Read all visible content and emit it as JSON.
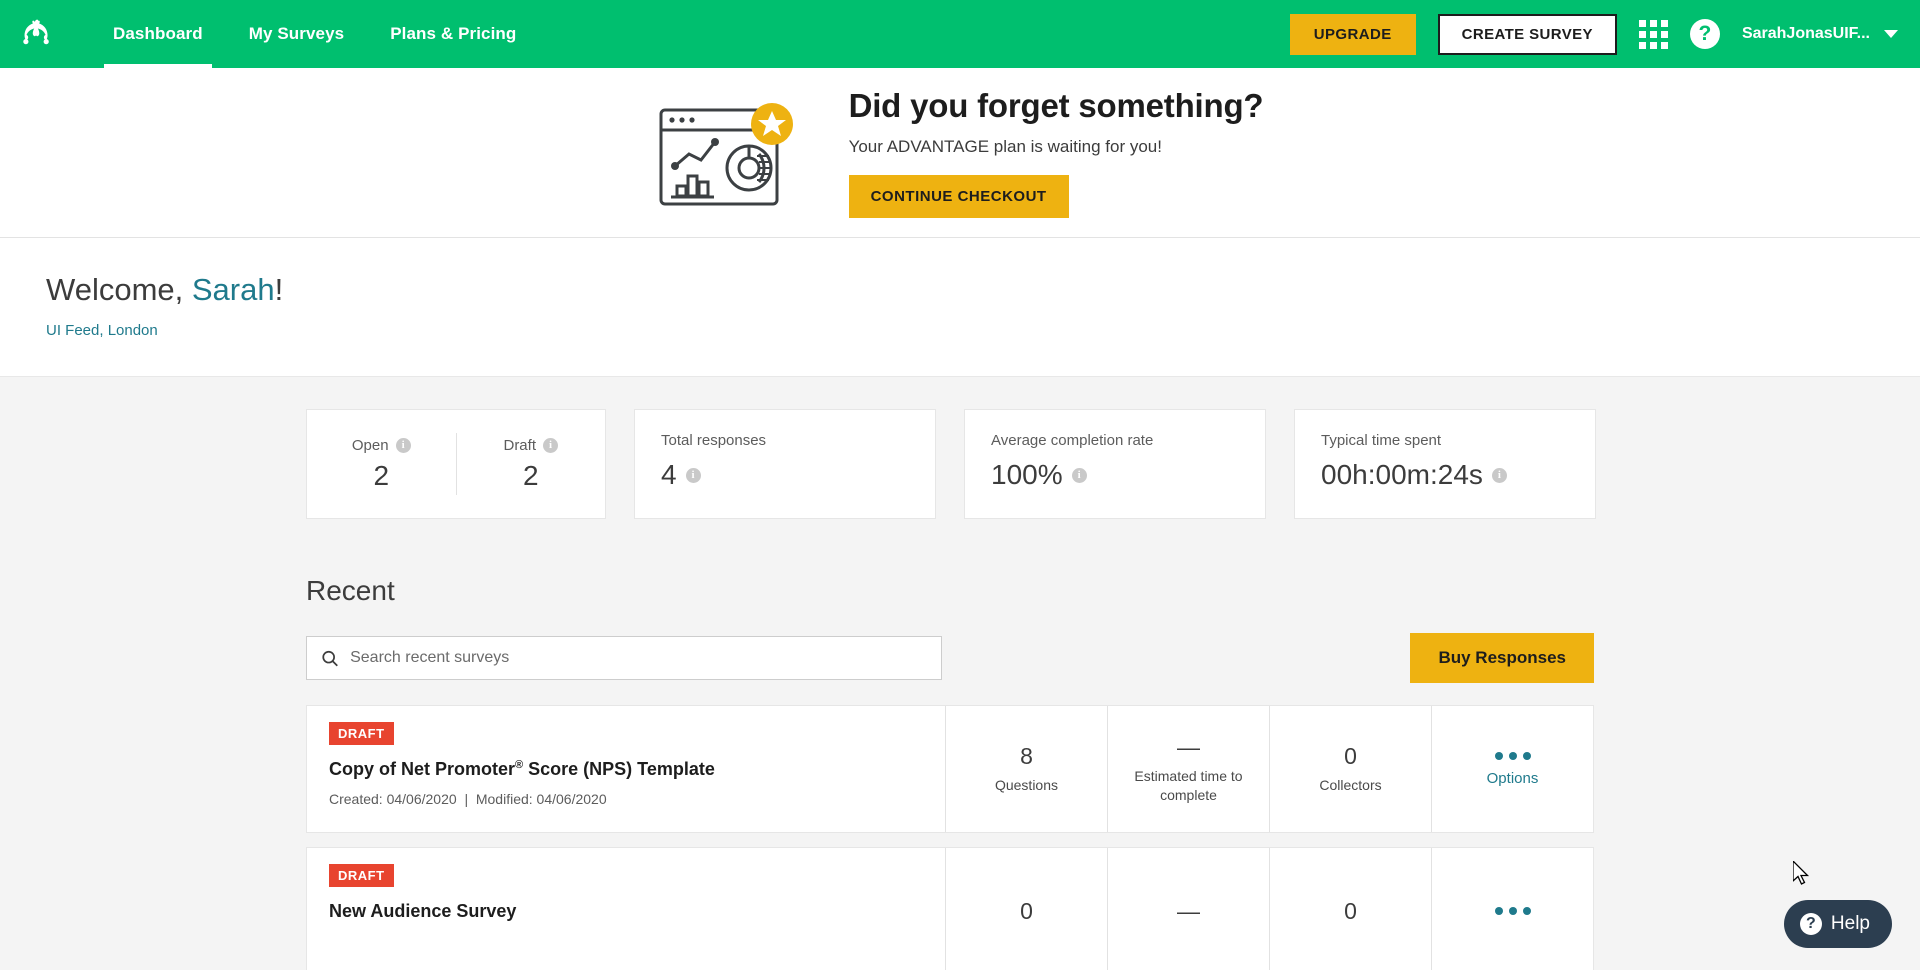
{
  "nav": {
    "logo_icon": "surveymonkey-logo-icon",
    "links": [
      {
        "label": "Dashboard",
        "active": true
      },
      {
        "label": "My Surveys",
        "active": false
      },
      {
        "label": "Plans & Pricing",
        "active": false
      }
    ],
    "upgrade_label": "UPGRADE",
    "create_survey_label": "CREATE SURVEY",
    "apps_icon": "grid-apps-icon",
    "help_icon": "question-mark-icon",
    "account_name": "SarahJonasUIF...",
    "caret_icon": "chevron-down-icon",
    "brand_green": "#00bf6f",
    "accent_yellow": "#eeb211"
  },
  "promo": {
    "art_icon": "analytics-window-star-icon",
    "headline": "Did you forget something?",
    "subtext": "Your ADVANTAGE plan is waiting for you!",
    "cta_label": "CONTINUE CHECKOUT"
  },
  "welcome": {
    "greeting_prefix": "Welcome, ",
    "name": "Sarah",
    "greeting_suffix": "!",
    "location": "UI Feed, London",
    "link_color": "#1f7a8c"
  },
  "stats": {
    "open": {
      "label": "Open",
      "value": "2",
      "info_icon": "info-icon"
    },
    "draft": {
      "label": "Draft",
      "value": "2",
      "info_icon": "info-icon"
    },
    "total_responses": {
      "label": "Total responses",
      "value": "4",
      "info_icon": "info-icon"
    },
    "completion_rate": {
      "label": "Average completion rate",
      "value": "100%",
      "info_icon": "info-icon"
    },
    "time_spent": {
      "label": "Typical time spent",
      "value": "00h:00m:24s",
      "info_icon": "info-icon"
    }
  },
  "recent": {
    "title": "Recent",
    "search_placeholder": "Search recent surveys",
    "search_value": "",
    "search_icon": "search-icon",
    "buy_label": "Buy Responses",
    "surveys": [
      {
        "status": "DRAFT",
        "title_html": "Copy of Net Promoter<sup>&reg;</sup> Score (NPS) Template",
        "created_label": "Created: 04/06/2020",
        "separator": "|",
        "modified_label": "Modified: 04/06/2020",
        "questions_value": "8",
        "questions_label": "Questions",
        "time_value": "—",
        "time_label": "Estimated time to complete",
        "collectors_value": "0",
        "collectors_label": "Collectors",
        "options_label": "Options",
        "options_icon": "ellipsis-icon"
      },
      {
        "status": "DRAFT",
        "title_html": "New Audience Survey",
        "created_label": "",
        "separator": "",
        "modified_label": "",
        "questions_value": "0",
        "questions_label": "",
        "time_value": "—",
        "time_label": "",
        "collectors_value": "0",
        "collectors_label": "",
        "options_label": "",
        "options_icon": "ellipsis-icon"
      }
    ]
  },
  "help_widget": {
    "label": "Help",
    "icon": "question-mark-icon"
  }
}
